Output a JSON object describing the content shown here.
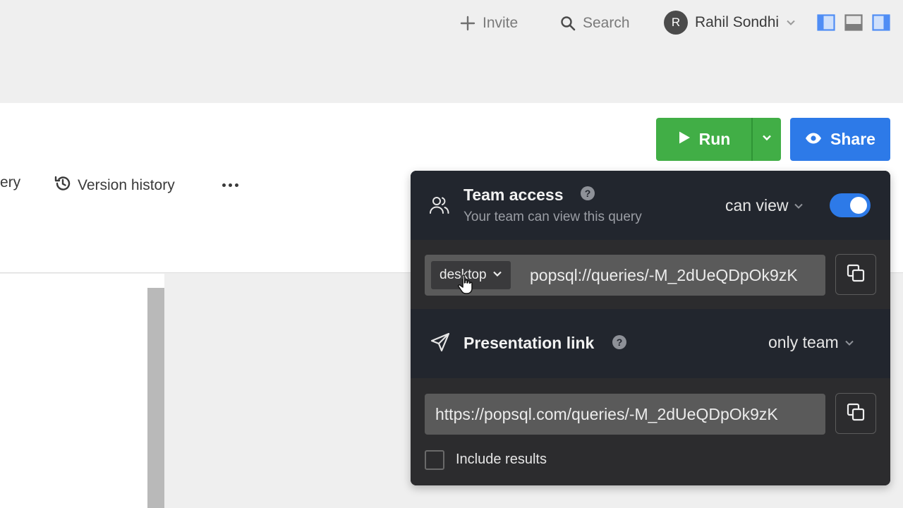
{
  "topbar": {
    "invite_label": "Invite",
    "search_label": "Search",
    "user_initial": "R",
    "user_name": "Rahil Sondhi"
  },
  "editor": {
    "nav_partial_label": "ery",
    "version_history_label": "Version history"
  },
  "actions": {
    "run_label": "Run",
    "share_label": "Share"
  },
  "share_popover": {
    "team_access": {
      "title": "Team access",
      "subtitle": "Your team can view this query",
      "permission": "can view",
      "enabled": true
    },
    "desktop_link": {
      "platform": "desktop",
      "url": "popsql://queries/-M_2dUeQDpOk9zK"
    },
    "presentation": {
      "title": "Presentation link",
      "visibility": "only team"
    },
    "web_link": {
      "url": "https://popsql.com/queries/-M_2dUeQDpOk9zK"
    },
    "include_results_label": "Include results",
    "include_results_checked": false
  },
  "colors": {
    "run_green": "#41ae46",
    "share_blue": "#2d7ae8",
    "popover_dark": "#22262e",
    "popover_mid": "#2c2c2e",
    "layout_icon_blue": "#4f8df5"
  }
}
